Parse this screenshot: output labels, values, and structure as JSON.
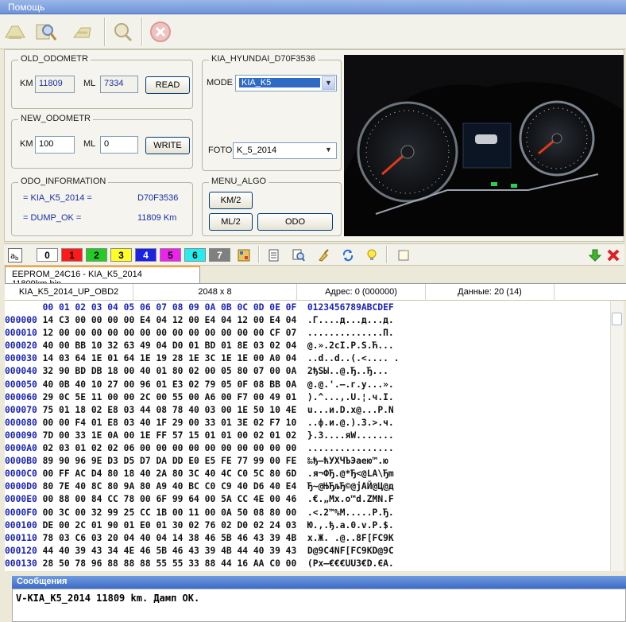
{
  "menubar": {
    "help_label": "Помощь"
  },
  "toolbar": {
    "icons": [
      "open-icon",
      "search-icon",
      "write-icon",
      "info-icon",
      "close-icon"
    ]
  },
  "old_odometr": {
    "title": "OLD_ODOMETR",
    "km_label": "KM",
    "km_value": "11809",
    "ml_label": "ML",
    "ml_value": "7334",
    "read_label": "READ"
  },
  "new_odometr": {
    "title": "NEW_ODOMETR",
    "km_label": "KM",
    "km_value": "100",
    "ml_label": "ML",
    "ml_value": "0",
    "write_label": "WRITE"
  },
  "odo_information": {
    "title": "ODO_INFORMATION",
    "line1_label": "= KIA_K5_2014 =",
    "line1_value": "D70F3536",
    "line2_label": "= DUMP_OK =",
    "line2_value": "11809 Km"
  },
  "kia_group": {
    "title": "KIA_HYUNDAI_D70F3536",
    "mode_label": "MODE",
    "mode_value": "KIA_K5",
    "foto_label": "FOTO",
    "foto_value": "K_5_2014"
  },
  "menu_algo": {
    "title": "MENU_ALGO",
    "km2_label": "KM/2",
    "ml2_label": "ML/2",
    "odo_label": "ODO"
  },
  "colors_toolbar": {
    "buttons": [
      {
        "label": "0",
        "bg": "#ffffff",
        "fg": "#000000"
      },
      {
        "label": "1",
        "bg": "#ff1a1a",
        "fg": "#000000"
      },
      {
        "label": "2",
        "bg": "#22cc22",
        "fg": "#000000"
      },
      {
        "label": "3",
        "bg": "#ffff22",
        "fg": "#000000"
      },
      {
        "label": "4",
        "bg": "#1a22e6",
        "fg": "#ffffff"
      },
      {
        "label": "5",
        "bg": "#ee22ee",
        "fg": "#000000"
      },
      {
        "label": "6",
        "bg": "#22eeee",
        "fg": "#000000"
      },
      {
        "label": "7",
        "bg": "#808080",
        "fg": "#ffffff"
      }
    ]
  },
  "tab": {
    "label": "EEPROM_24C16 - KIA_K5_2014 11809km.bin"
  },
  "infobar": {
    "name": "KIA_K5_2014_UP_OBD2",
    "size": "2048 x 8",
    "address": "Адрес: 0 (000000)",
    "data": "Данные: 20 (14)"
  },
  "hex": {
    "header": "       00 01 02 03 04 05 06 07 08 09 0A 0B 0C 0D 0E 0F  0123456789ABCDEF",
    "rows": [
      {
        "off": "000000",
        "bytes": "14 C3 00 00 00 00 E4 04 12 00 E4 04 12 00 E4 04",
        "ascii": ".Г....д...д...д."
      },
      {
        "off": "000010",
        "bytes": "12 00 00 00 00 00 00 00 00 00 00 00 00 00 CF 07",
        "ascii": "..............П."
      },
      {
        "off": "000020",
        "bytes": "40 00 BB 10 32 63 49 04 D0 01 BD 01 8E 03 02 04",
        "ascii": "@.».2cI.Р.Ѕ.Ћ..."
      },
      {
        "off": "000030",
        "bytes": "14 03 64 1E 01 64 1E 19 28 1E 3C 1E 1E 00 A0 04",
        "ascii": "..d..d..(.<.... ."
      },
      {
        "off": "000040",
        "bytes": "32 90 BD DB 18 00 40 01 80 02 00 05 80 07 00 0A",
        "ascii": "2ђЅЫ..@.Ђ..Ђ..."
      },
      {
        "off": "000050",
        "bytes": "40 0B 40 10 27 00 96 01 E3 02 79 05 0F 08 BB 0A",
        "ascii": "@.@.'.–.г.y...»."
      },
      {
        "off": "000060",
        "bytes": "29 0C 5E 11 00 00 2C 00 55 00 A6 00 F7 00 49 01",
        "ascii": ").^...,.U.¦.ч.I."
      },
      {
        "off": "000070",
        "bytes": "75 01 18 02 E8 03 44 08 78 40 03 00 1E 50 10 4E",
        "ascii": "u...и.D.x@...P.N"
      },
      {
        "off": "000080",
        "bytes": "00 00 F4 01 E8 03 40 1F 29 00 33 01 3E 02 F7 10",
        "ascii": "..ф.и.@.).3.>.ч."
      },
      {
        "off": "000090",
        "bytes": "7D 00 33 1E 0A 00 1E FF 57 15 01 01 00 02 01 02",
        "ascii": "}.3....яW......."
      },
      {
        "off": "0000A0",
        "bytes": "02 03 01 02 02 06 00 00 00 00 00 00 00 00 00 00",
        "ascii": "................"
      },
      {
        "off": "0000B0",
        "bytes": "89 90 96 9E D3 D5 D7 DA DD E0 E5 FE 77 99 00 FE",
        "ascii": "‰ђ–ћУХЧЪЭаею™.ю"
      },
      {
        "off": "0000C0",
        "bytes": "00 FF AC D4 80 18 40 2A 80 3C 40 4C C0 5C 80 6D",
        "ascii": ".я¬ФЂ.@*Ђ<@LА\\Ђm"
      },
      {
        "off": "0000D0",
        "bytes": "80 7E 40 8C 80 9A 80 A9 40 BC C0 C9 40 D6 40 E4",
        "ascii": "Ђ~@ЊЂљЂ©@јАЙ@Ц@д"
      },
      {
        "off": "0000E0",
        "bytes": "00 88 00 84 CC 78 00 6F 99 64 00 5A CC 4E 00 46",
        "ascii": ".€.„Мx.o™d.ZМN.F"
      },
      {
        "off": "0000F0",
        "bytes": "00 3C 00 32 99 25 CC 1B 00 11 00 0A 50 08 80 00",
        "ascii": ".<.2™%М.....P.Ђ."
      },
      {
        "off": "000100",
        "bytes": "DE 00 2C 01 90 01 E0 01 30 02 76 02 D0 02 24 03",
        "ascii": "Ю.,.ђ.а.0.v.Р.$."
      },
      {
        "off": "000110",
        "bytes": "78 03 C6 03 20 04 40 04 14 38 46 5B 46 43 39 4B",
        "ascii": "x.Ж. .@..8F[FC9K"
      },
      {
        "off": "000120",
        "bytes": "44 40 39 43 34 4E 46 5B 46 43 39 4B 44 40 39 43",
        "ascii": "D@9C4NF[FC9KD@9C"
      },
      {
        "off": "000130",
        "bytes": "28 50 78 96 88 88 88 55 55 33 88 44 16 AA C0 00",
        "ascii": "(Px–€€€UU3€D.ЄА."
      }
    ]
  },
  "messages": {
    "title": "Сообщения",
    "text": "V-KIA_K5_2014 11809 km. Дамп OK."
  }
}
